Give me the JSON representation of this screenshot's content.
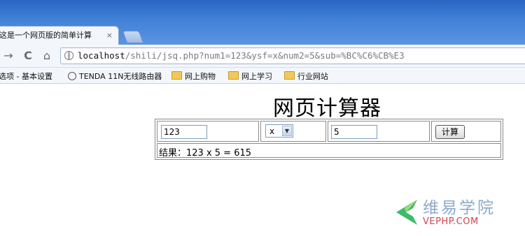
{
  "browser": {
    "tab_title": "这是一个网页版的简单计算",
    "tab_close": "×",
    "url_host": "localhost",
    "url_rest": "/shili/jsq.php?num1=123&ysf=x&num2=5&sub=%BC%C6%CB%E3",
    "bookmarks": {
      "options": "选项 - 基本设置",
      "tenda": "TENDA 11N无线路由器",
      "folders": [
        "网上购物",
        "网上学习",
        "行业网站"
      ]
    }
  },
  "page": {
    "heading": "网页计算器",
    "num1": "123",
    "operator": "x",
    "num2": "5",
    "submit_label": "计算",
    "result": "结果：123 x 5 = 615"
  },
  "watermark": {
    "cn": "维易学院",
    "en": "VEPHP.COM"
  },
  "colors": {
    "titlebar": "#3f7fd6",
    "watermark_green": "#3dbb6a",
    "watermark_red": "#d4434e"
  }
}
